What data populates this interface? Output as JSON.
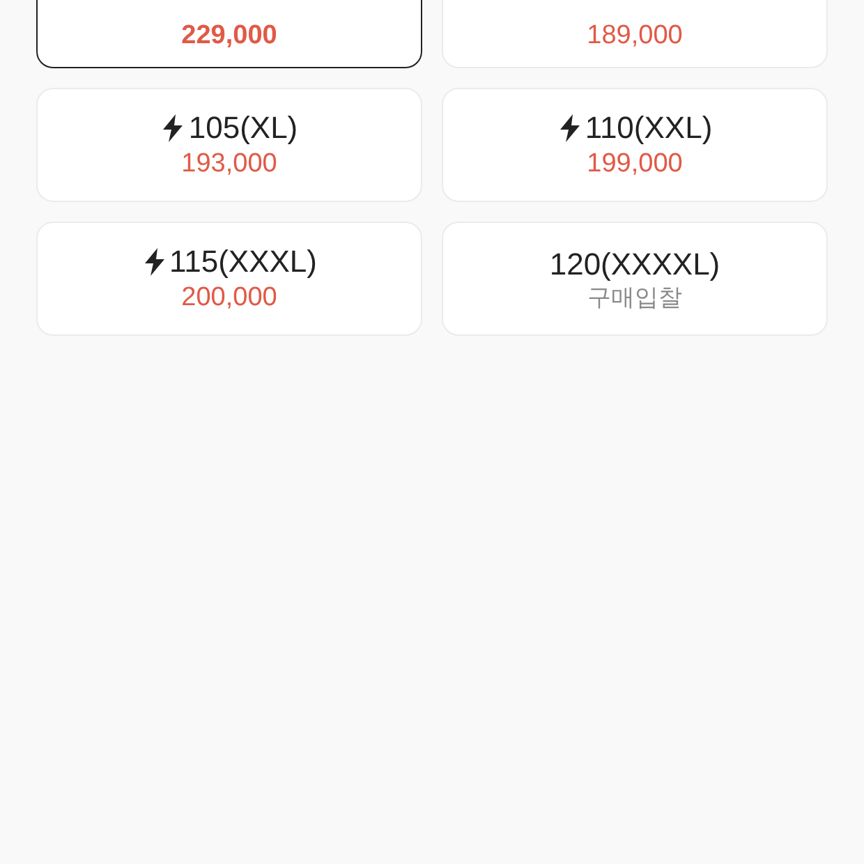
{
  "sizes": [
    {
      "price": "229,000",
      "kind": "price",
      "selected": true
    },
    {
      "price": "189,000",
      "kind": "price",
      "selected": false
    },
    {
      "label": "105(XL)",
      "express": true,
      "price": "193,000",
      "kind": "price",
      "selected": false
    },
    {
      "label": "110(XXL)",
      "express": true,
      "price": "199,000",
      "kind": "price",
      "selected": false
    },
    {
      "label": "115(XXXL)",
      "express": true,
      "price": "200,000",
      "kind": "price",
      "selected": false
    },
    {
      "label": "120(XXXXL)",
      "express": false,
      "price": "구매입찰",
      "kind": "bid",
      "selected": false
    }
  ]
}
